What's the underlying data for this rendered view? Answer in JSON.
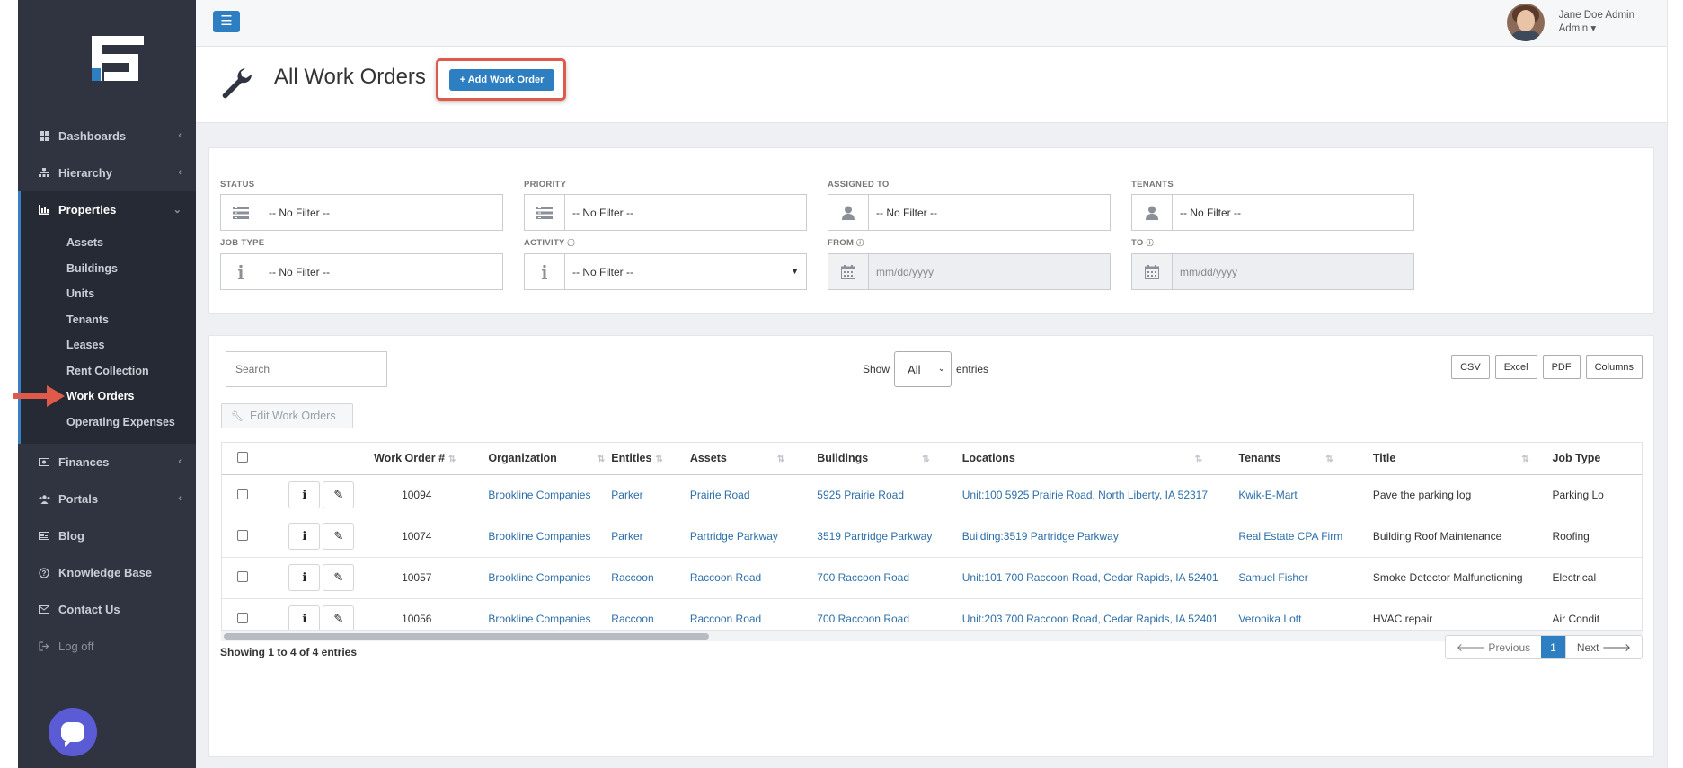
{
  "sidebar": {
    "items": [
      {
        "label": "Dashboards",
        "icon": "dashboard-icon",
        "has_children": true
      },
      {
        "label": "Hierarchy",
        "icon": "sitemap-icon",
        "has_children": true
      },
      {
        "label": "Properties",
        "icon": "bar-chart-icon",
        "has_children": true,
        "expanded": true
      },
      {
        "label": "Finances",
        "icon": "money-icon",
        "has_children": true
      },
      {
        "label": "Portals",
        "icon": "users-icon",
        "has_children": true
      },
      {
        "label": "Blog",
        "icon": "newspaper-icon",
        "has_children": false
      },
      {
        "label": "Knowledge Base",
        "icon": "question-circle-icon",
        "has_children": false
      },
      {
        "label": "Contact Us",
        "icon": "envelope-icon",
        "has_children": false
      },
      {
        "label": "Log off",
        "icon": "sign-out-icon",
        "has_children": false
      }
    ],
    "properties_sub": [
      "Assets",
      "Buildings",
      "Units",
      "Tenants",
      "Leases",
      "Rent Collection",
      "Work Orders",
      "Operating Expenses"
    ],
    "current_sub": "Work Orders"
  },
  "topbar": {
    "menu_icon": "☰",
    "user_name": "Jane Doe Admin",
    "user_role": "Admin ▾"
  },
  "header": {
    "title": "All Work Orders",
    "add_button": "+ Add Work Order"
  },
  "filters": {
    "status": {
      "label": "STATUS",
      "value": "-- No Filter --"
    },
    "priority": {
      "label": "PRIORITY",
      "value": "-- No Filter --"
    },
    "assigned_to": {
      "label": "ASSIGNED TO",
      "value": "-- No Filter --"
    },
    "tenants": {
      "label": "TENANTS",
      "value": "-- No Filter --"
    },
    "job_type": {
      "label": "JOB TYPE",
      "value": "-- No Filter --"
    },
    "activity": {
      "label": "ACTIVITY",
      "value": "-- No Filter --"
    },
    "from": {
      "label": "FROM",
      "placeholder": "mm/dd/yyyy"
    },
    "to": {
      "label": "TO",
      "placeholder": "mm/dd/yyyy"
    }
  },
  "table_controls": {
    "search_placeholder": "Search",
    "show_label": "Show",
    "show_value": "All",
    "entries_label": "entries",
    "export_buttons": [
      "CSV",
      "Excel",
      "PDF",
      "Columns"
    ],
    "edit_button": "Edit Work Orders"
  },
  "table": {
    "columns": [
      "Work Order #",
      "Organization",
      "Entities",
      "Assets",
      "Buildings",
      "Locations",
      "Tenants",
      "Title",
      "Job Type"
    ],
    "rows": [
      {
        "wo": "10094",
        "org": "Brookline Companies",
        "entity": "Parker",
        "asset": "Prairie Road",
        "building": "5925 Prairie Road",
        "location": "Unit:100 5925 Prairie Road, North Liberty, IA 52317",
        "tenant": "Kwik-E-Mart",
        "title": "Pave the parking log",
        "job_type": "Parking Lo"
      },
      {
        "wo": "10074",
        "org": "Brookline Companies",
        "entity": "Parker",
        "asset": "Partridge Parkway",
        "building": "3519 Partridge Parkway",
        "location": "Building:3519 Partridge Parkway",
        "tenant": "Real Estate CPA Firm",
        "title": "Building Roof Maintenance",
        "job_type": "Roofing"
      },
      {
        "wo": "10057",
        "org": "Brookline Companies",
        "entity": "Raccoon",
        "asset": "Raccoon Road",
        "building": "700 Raccoon Road",
        "location": "Unit:101 700 Raccoon Road, Cedar Rapids, IA 52401",
        "tenant": "Samuel Fisher",
        "title": "Smoke Detector Malfunctioning",
        "job_type": "Electrical"
      },
      {
        "wo": "10056",
        "org": "Brookline Companies",
        "entity": "Raccoon",
        "asset": "Raccoon Road",
        "building": "700 Raccoon Road",
        "location": "Unit:203 700 Raccoon Road, Cedar Rapids, IA 52401",
        "tenant": "Veronika Lott",
        "title": "HVAC repair",
        "job_type": "Air Condit"
      }
    ]
  },
  "footer": {
    "showing": "Showing 1 to 4 of 4 entries",
    "prev": "🡐 Previous",
    "page": "1",
    "next": "Next 🡒"
  },
  "colors": {
    "sidebar_bg": "#2f3440",
    "accent": "#2d7fc1",
    "link": "#2d6ea8",
    "annotation_red": "#e05a4a"
  }
}
